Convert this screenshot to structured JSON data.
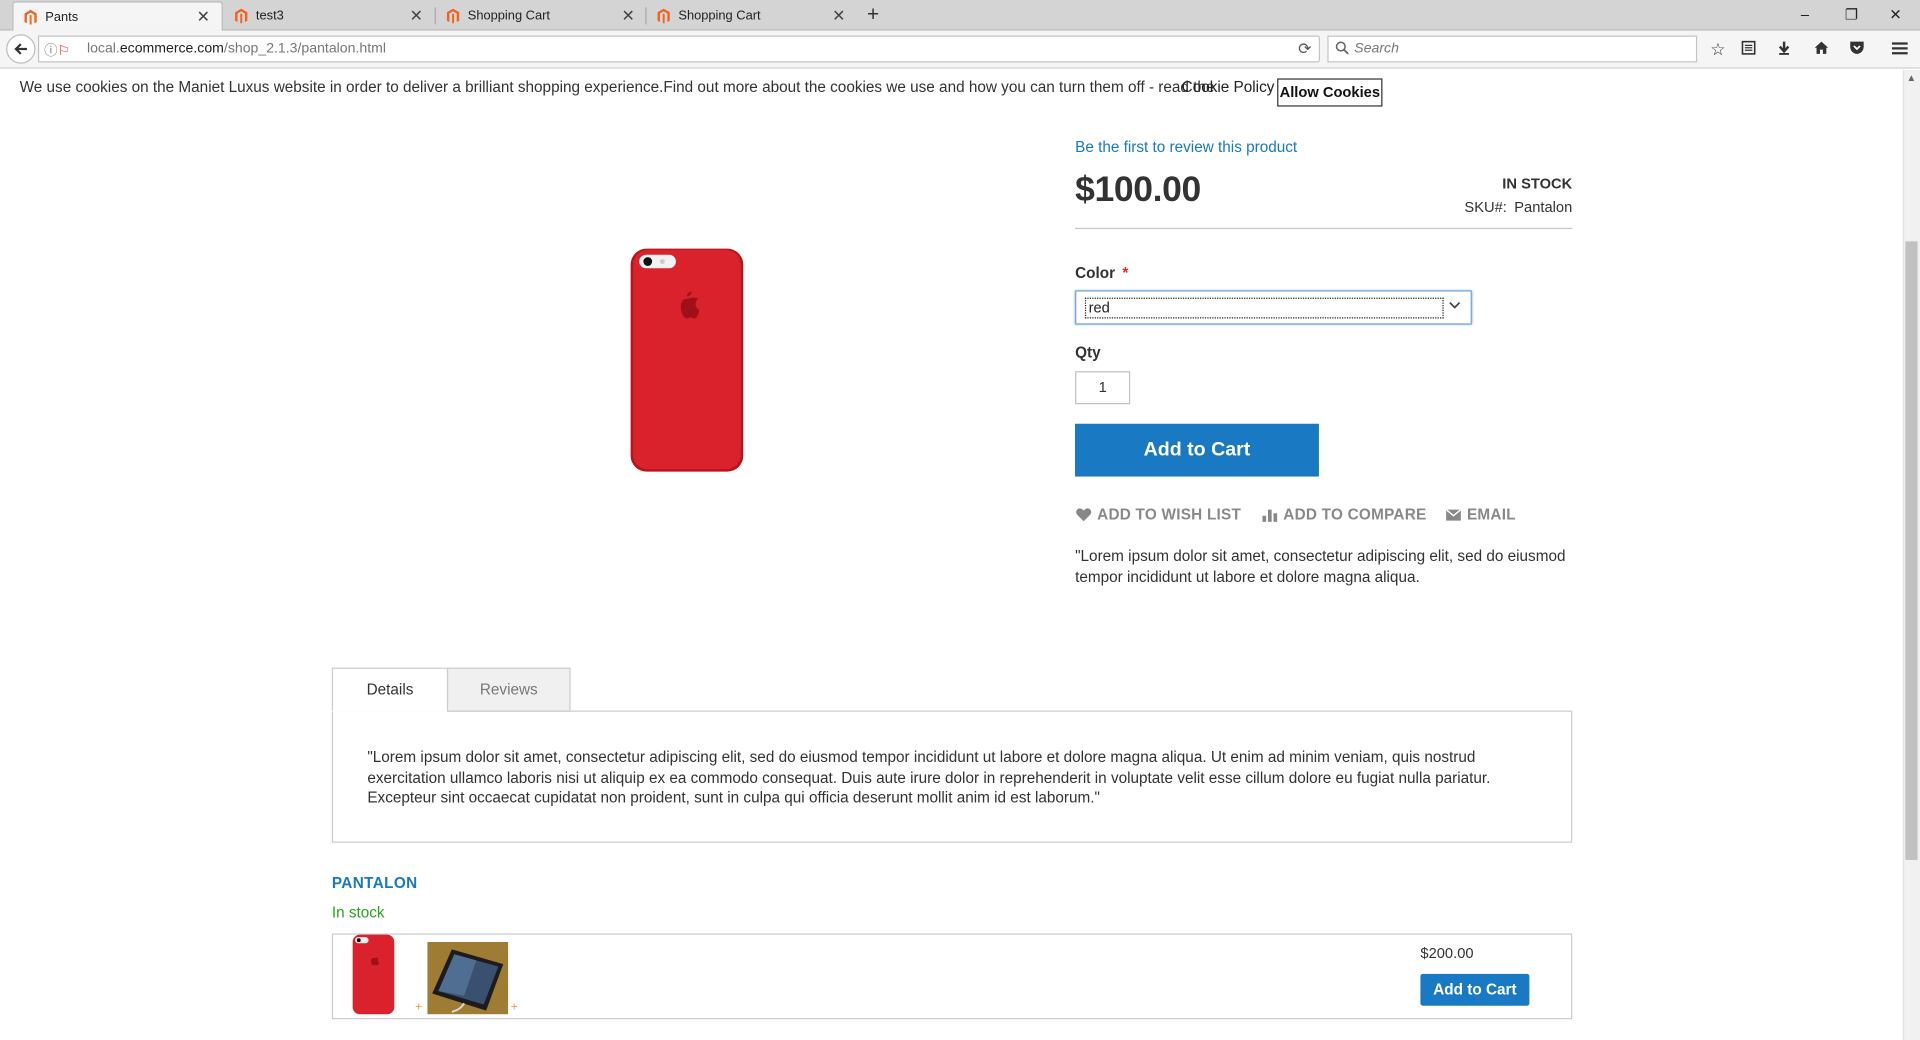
{
  "browser": {
    "tabs": [
      {
        "title": "Pants",
        "active": true
      },
      {
        "title": "test3",
        "active": false
      },
      {
        "title": "Shopping Cart",
        "active": false
      },
      {
        "title": "Shopping Cart",
        "active": false
      }
    ],
    "new_tab": "+",
    "url_prefix": "local.",
    "url_host": "ecommerce.com",
    "url_path": "/shop_2.1.3/pantalon.html",
    "search_placeholder": "Search",
    "window_controls": {
      "minimize": "–",
      "restore": "❐",
      "close": "✕"
    }
  },
  "cookie": {
    "message": "We use cookies on the Maniet Luxus website in order to deliver a brilliant shopping experience.Find out more about the cookies we use and how you can turn them off - read the",
    "policy_link": "Cookie Policy",
    "allow_button": "Allow Cookies"
  },
  "product": {
    "review_link": "Be the first to review this product",
    "price": "$100.00",
    "stock": "IN STOCK",
    "sku_label": "SKU#:",
    "sku": "Pantalon",
    "color_label": "Color",
    "required_mark": "*",
    "color_value": "red",
    "qty_label": "Qty",
    "qty_value": "1",
    "add_to_cart": "Add to Cart",
    "actions": {
      "wishlist": "ADD TO WISH LIST",
      "compare": "ADD TO COMPARE",
      "email": "EMAIL"
    },
    "short_description": "\"Lorem ipsum dolor sit amet, consectetur adipiscing elit, sed do eiusmod tempor incididunt ut labore et dolore magna aliqua."
  },
  "info_tabs": {
    "details": "Details",
    "reviews": "Reviews",
    "details_text": "\"Lorem ipsum dolor sit amet, consectetur adipiscing elit, sed do eiusmod tempor incididunt ut labore et dolore magna aliqua. Ut enim ad minim veniam, quis nostrud exercitation ullamco laboris nisi ut aliquip ex ea commodo consequat. Duis aute irure dolor in reprehenderit in voluptate velit esse cillum dolore eu fugiat nulla pariatur. Excepteur sint occaecat cupidatat non proident, sunt in culpa qui officia deserunt mollit anim id est laborum.\""
  },
  "bundle": {
    "name": "PANTALON",
    "stock": "In stock",
    "plus": "+",
    "price": "$200.00",
    "add_to_cart": "Add to Cart"
  },
  "colors": {
    "accent": "#1979c3",
    "in_stock_green": "#2aa320",
    "phone_red": "#d9222b",
    "magento_orange": "#f26322"
  }
}
